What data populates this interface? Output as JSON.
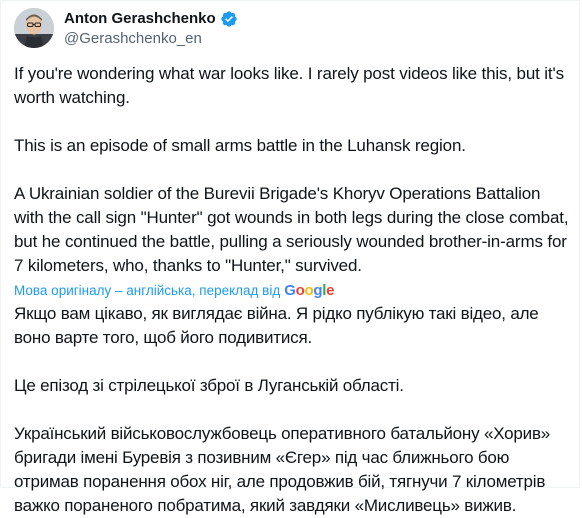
{
  "author": {
    "display_name": "Anton Gerashchenko",
    "handle": "@Gerashchenko_en",
    "verified_color": "#1d9bf0"
  },
  "tweet": {
    "paragraphs": [
      "If you're wondering what war looks like. I rarely post videos like this, but it's worth watching.",
      "This is an episode of small arms battle in the Luhansk region.",
      "A Ukrainian soldier of the Burevii Brigade's Khoryv Operations Battalion with the call sign \"Hunter\" got wounds in both legs during the close combat, but he continued the battle, pulling a seriously wounded brother-in-arms for 7 kilometers, who, thanks to \"Hunter,\" survived."
    ]
  },
  "translation": {
    "label": "Мова оригіналу – англійська, переклад від",
    "provider_letters": [
      "G",
      "o",
      "o",
      "g",
      "l",
      "e"
    ],
    "paragraphs": [
      "Якщо вам цікаво, як виглядає війна. Я рідко публікую такі відео, але воно варте того, щоб його подивитися.",
      "Це епізод зі стрілецької зброї в Луганській області.",
      "Український військовослужбовець оперативного батальйону «Хорив» бригади імені Буревія з позивним «Єгер» під час ближнього бою отримав поранення обох ніг, але продовжив бій, тягнучи 7 кілометрів важко пораненого побратима, який завдяки «Мисливець» вижив."
    ]
  },
  "colors": {
    "text": "#0f1419",
    "secondary": "#536471",
    "link": "#1d9bf0"
  }
}
